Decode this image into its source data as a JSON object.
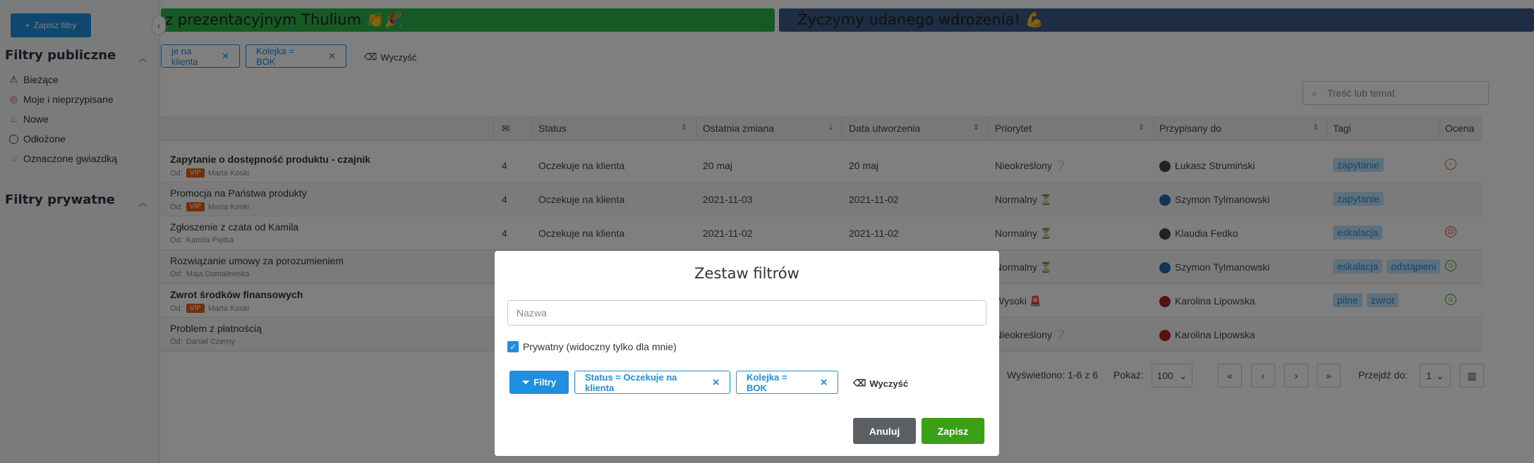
{
  "sidebar": {
    "save_filters_label": "Zapisz filtry",
    "public_title": "Filtry publiczne",
    "private_title": "Filtry prywatne",
    "items": [
      {
        "label": "Bieżące",
        "icon": "warning-icon"
      },
      {
        "label": "Moje i nieprzypisane",
        "icon": "target-icon"
      },
      {
        "label": "Nowe",
        "icon": "fire-icon"
      },
      {
        "label": "Odłożone",
        "icon": "chat-icon"
      },
      {
        "label": "Oznaczone gwiazdką",
        "icon": "star-icon"
      }
    ]
  },
  "banners": {
    "green": "z prezentacyjnym Thulium 👏🎉",
    "blue": "Życzymy udanego wdrożenia! 💪"
  },
  "active_filters": {
    "chip1": "je na klienta",
    "chip2": "Kolejka = BOK",
    "clear": "Wyczyść"
  },
  "search": {
    "placeholder": "Treść lub temat"
  },
  "table": {
    "headers": [
      "Status",
      "Ostatnia zmiana",
      "Data utworzenia",
      "Priorytet",
      "Przypisany do",
      "Tagi",
      "Ocena"
    ],
    "rows": [
      {
        "subject": "Zapytanie o dostępność produktu - czajnik",
        "from_label": "Od:",
        "vip": "VIP",
        "from": "Marta Koski",
        "count": "4",
        "status": "Oczekuje na klienta",
        "changed": "20 maj",
        "created": "20 maj",
        "priority": "Nieokreślony ❔",
        "assigned": "Łukasz Strumiński",
        "tags": [
          "zapytanie"
        ],
        "rating": "neutral"
      },
      {
        "subject": "Promocja na Państwa produkty",
        "from_label": "Od:",
        "vip": "VIP",
        "from": "Marta Koski",
        "count": "4",
        "status": "Oczekuje na klienta",
        "changed": "2021-11-03",
        "created": "2021-11-02",
        "priority": "Normalny ⏳",
        "assigned": "Szymon Tylmanowski",
        "tags": [
          "zapytanie"
        ],
        "rating": ""
      },
      {
        "subject": "Zgłoszenie z czata od Kamila",
        "from_label": "Od:",
        "vip": "",
        "from": "Kamila Piętka",
        "count": "4",
        "status": "Oczekuje na klienta",
        "changed": "2021-11-02",
        "created": "2021-11-02",
        "priority": "Normalny ⏳",
        "assigned": "Klaudia Fedko",
        "tags": [
          "eskalacja"
        ],
        "rating": "sad"
      },
      {
        "subject": "Rozwiązanie umowy za porozumieniem",
        "from_label": "Od:",
        "vip": "",
        "from": "Maja Domalewska",
        "count": "",
        "status": "",
        "changed": "",
        "created": "",
        "priority": "Normalny ⏳",
        "assigned": "Szymon Tylmanowski",
        "tags": [
          "eskalacja",
          "odstąpieni"
        ],
        "rating": "happy"
      },
      {
        "subject": "Zwrot środków finansowych",
        "from_label": "Od:",
        "vip": "VIP",
        "from": "Marta Koski",
        "count": "",
        "status": "",
        "changed": "",
        "created": "",
        "priority": "Wysoki 🚨",
        "assigned": "Karolina Lipowska",
        "tags": [
          "pilne",
          "zwrot"
        ],
        "rating": "happy"
      },
      {
        "subject": "Problem z płatnością",
        "from_label": "Od:",
        "vip": "",
        "from": "Daniel Czerny",
        "count": "",
        "status": "",
        "changed": "",
        "created": "",
        "priority": "Nieokreślony ❔",
        "assigned": "Karolina Lipowska",
        "tags": [],
        "rating": ""
      }
    ]
  },
  "pager": {
    "shown": "Wyświetlono: 1-6 z 6",
    "show_label": "Pokaż:",
    "per_page": "100",
    "goto_label": "Przejdź do:",
    "page": "1"
  },
  "modal": {
    "title": "Zestaw filtrów",
    "name_placeholder": "Nazwa",
    "private_label": "Prywatny (widoczny tylko dla mnie)",
    "filters_label": "Filtry",
    "chip1": "Status = Oczekuje na klienta",
    "chip2": "Kolejka = BOK",
    "clear": "Wyczyść",
    "cancel": "Anuluj",
    "save": "Zapisz"
  },
  "colors": {
    "accent": "#1e8fe1",
    "save": "#3aa018",
    "cancel": "#5b5e63",
    "vip": "#e65c15"
  }
}
